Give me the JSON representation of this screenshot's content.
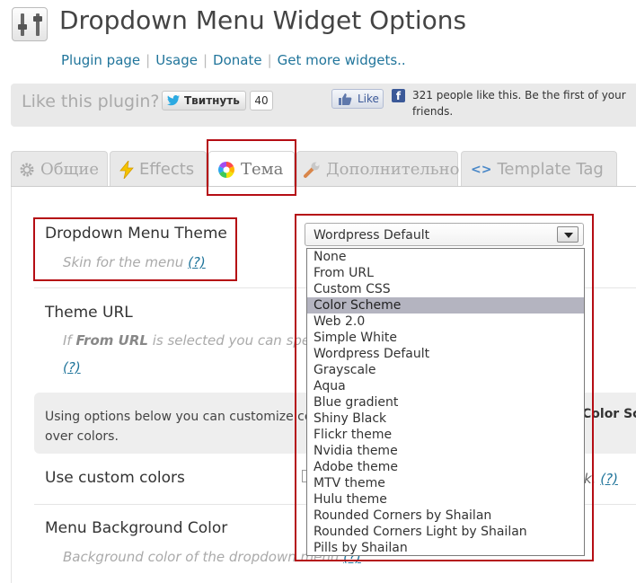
{
  "header": {
    "icon": "settings-sliders-icon",
    "title": "Dropdown Menu Widget Options",
    "links": [
      "Plugin page",
      "Usage",
      "Donate",
      "Get more widgets.."
    ]
  },
  "social": {
    "prompt": "Like this plugin?",
    "tweet_label": "Твитнуть",
    "tweet_count": "40",
    "like_label": "Like",
    "fb_text": "321 people like this. Be the first of your friends."
  },
  "tabs": [
    {
      "label": "Общие",
      "icon": "gear-icon"
    },
    {
      "label": "Effects",
      "icon": "lightning-icon"
    },
    {
      "label": "Тема",
      "icon": "color-wheel-icon"
    },
    {
      "label": "Дополнительно",
      "icon": "wrench-icon"
    },
    {
      "label": "Template Tag",
      "icon": "code-icon"
    }
  ],
  "fields": {
    "theme_label": "Dropdown Menu Theme",
    "theme_desc": "Skin for the menu",
    "help": "(?)",
    "url_label": "Theme URL",
    "url_desc_prefix": "If ",
    "url_desc_bold": "From URL",
    "url_desc_suffix": " is selected you can spec",
    "info_line1": "Using options below you can customize cer",
    "info_line2": "over colors.",
    "info_right": "Color Sch",
    "custom_label": "Use custom colors",
    "custom_right": "k.",
    "bg_label": "Menu Background Color",
    "bg_desc": "Background color of the dropdown menu"
  },
  "theme_select": {
    "selected": "Wordpress Default",
    "highlighted": "Color Scheme",
    "options": [
      "None",
      "From URL",
      "Custom CSS",
      "Color Scheme",
      "Web 2.0",
      "Simple White",
      "Wordpress Default",
      "Grayscale",
      "Aqua",
      "Blue gradient",
      "Shiny Black",
      "Flickr theme",
      "Nvidia theme",
      "Adobe theme",
      "MTV theme",
      "Hulu theme",
      "Rounded Corners by Shailan",
      "Rounded Corners Light by Shailan",
      "Pills by Shailan"
    ]
  },
  "colors": {
    "link": "#21759b",
    "highlight_frame": "#b50d14",
    "selected_option_bg": "#b4b4c0"
  }
}
